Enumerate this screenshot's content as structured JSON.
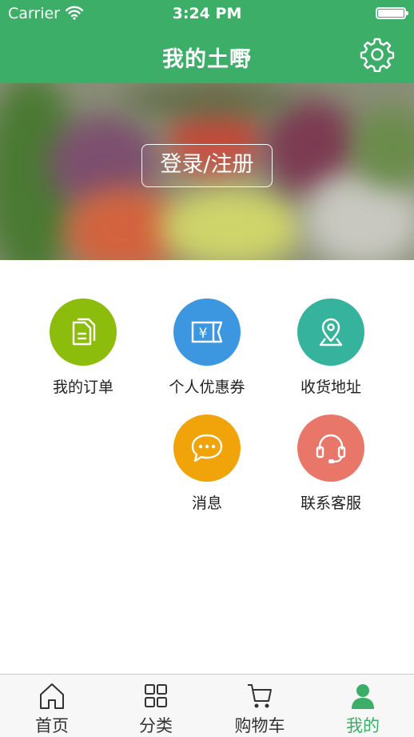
{
  "status_bar": {
    "carrier": "Carrier",
    "time": "3:24 PM"
  },
  "nav": {
    "title": "我的土嘢",
    "settings_icon": "gear-icon"
  },
  "banner": {
    "login_label": "登录/注册"
  },
  "menu": [
    {
      "label": "我的订单",
      "icon": "orders-icon",
      "color": "#8cbd0c"
    },
    {
      "label": "个人优惠券",
      "icon": "coupon-icon",
      "color": "#3d97e0"
    },
    {
      "label": "收货地址",
      "icon": "location-icon",
      "color": "#36b39c"
    },
    {
      "label": "消息",
      "icon": "message-icon",
      "color": "#f0a40a"
    },
    {
      "label": "联系客服",
      "icon": "headset-icon",
      "color": "#e8776a"
    }
  ],
  "tab_bar": {
    "active_color": "#3cae67",
    "items": [
      {
        "label": "首页",
        "icon": "home-icon"
      },
      {
        "label": "分类",
        "icon": "grid-icon"
      },
      {
        "label": "购物车",
        "icon": "cart-icon"
      },
      {
        "label": "我的",
        "icon": "person-icon",
        "active": true
      }
    ]
  }
}
